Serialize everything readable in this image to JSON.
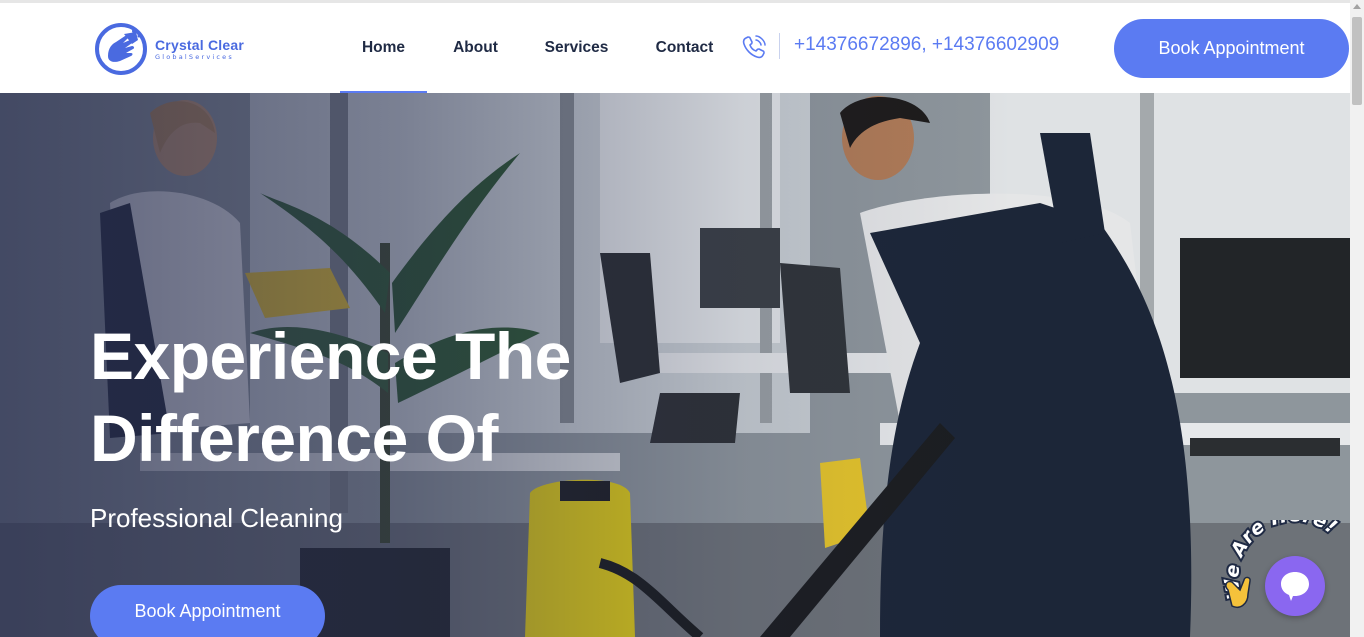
{
  "brand": {
    "name": "Crystal Clear",
    "tagline": "GlobalServices"
  },
  "nav": {
    "items": [
      {
        "label": "Home",
        "active": true
      },
      {
        "label": "About",
        "active": false
      },
      {
        "label": "Services",
        "active": false
      },
      {
        "label": "Contact",
        "active": false
      }
    ]
  },
  "contact": {
    "phones": "+14376672896, +14376602909",
    "icon": "phone-ringing-icon"
  },
  "header": {
    "cta_label": "Book Appointment"
  },
  "hero": {
    "title_line1": "Experience The",
    "title_line2": "Difference Of",
    "subtitle": "Professional Cleaning",
    "cta_label": "Book Appointment",
    "image": "office-cleaning-photo"
  },
  "chat_widget": {
    "badge_text": "We Are Here!",
    "icon": "chat-bubble-icon",
    "emoji": "waving-hand-icon"
  },
  "colors": {
    "accent": "#5b7bf2",
    "nav_text": "#1f2a44",
    "chat": "#8a67f0"
  }
}
